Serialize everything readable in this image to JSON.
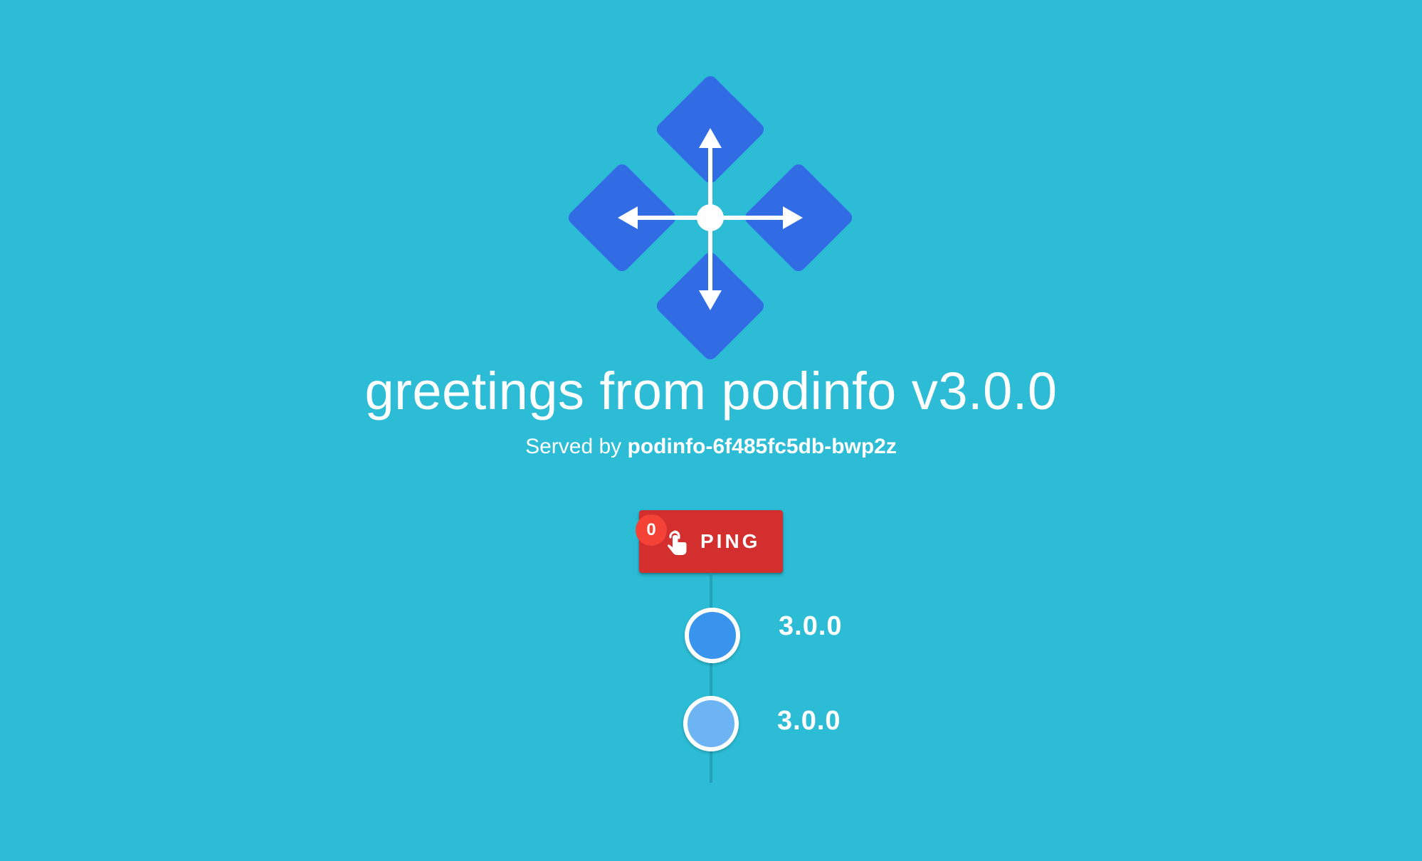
{
  "header": {
    "title": "greetings from podinfo v3.0.0",
    "served_by_label": "Served by",
    "hostname": "podinfo-6f485fc5db-bwp2z"
  },
  "logo": {
    "icon": "podinfo-logo-icon",
    "diamond_color": "#326ce5",
    "arrow_color": "#ffffff"
  },
  "ping": {
    "label": "PING",
    "count": "0",
    "icon": "touch-app-icon",
    "color": "#d32f2f",
    "badge_color": "#f44336"
  },
  "timeline": {
    "items": [
      {
        "version": "3.0.0",
        "color": "#3994ee"
      },
      {
        "version": "3.0.0",
        "color": "#6cb4f4"
      }
    ]
  },
  "theme": {
    "background": "#2cbcd5"
  }
}
